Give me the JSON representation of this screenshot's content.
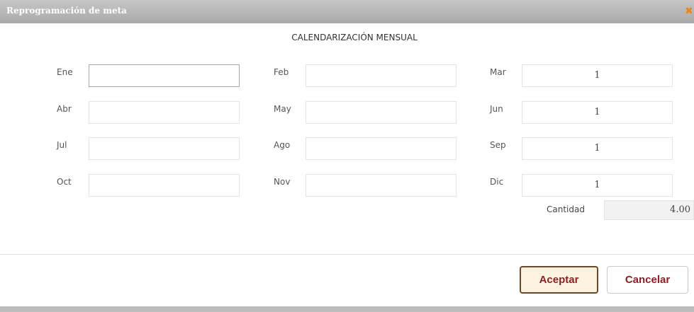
{
  "dialog": {
    "title": "Reprogramación de meta",
    "close_icon": "close-icon"
  },
  "heading": "CALENDARIZACIÓN MENSUAL",
  "months": [
    {
      "label": "Ene",
      "value": ""
    },
    {
      "label": "Feb",
      "value": ""
    },
    {
      "label": "Mar",
      "value": "1"
    },
    {
      "label": "Abr",
      "value": ""
    },
    {
      "label": "May",
      "value": ""
    },
    {
      "label": "Jun",
      "value": "1"
    },
    {
      "label": "Jul",
      "value": ""
    },
    {
      "label": "Ago",
      "value": ""
    },
    {
      "label": "Sep",
      "value": "1"
    },
    {
      "label": "Oct",
      "value": ""
    },
    {
      "label": "Nov",
      "value": ""
    },
    {
      "label": "Dic",
      "value": "1"
    }
  ],
  "quantity": {
    "label": "Cantidad",
    "value": "4.00"
  },
  "buttons": {
    "accept": "Aceptar",
    "cancel": "Cancelar"
  },
  "colors": {
    "title_bar": "#b5b5b5",
    "button_text": "#8b1f26",
    "accept_bg": "#fbf3e0",
    "close_icon": "#e7891a"
  }
}
